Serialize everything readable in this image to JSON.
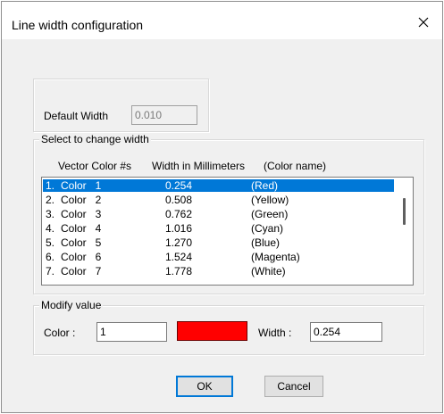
{
  "window": {
    "title": "Line width configuration",
    "close_glyph": "✕"
  },
  "default_width": {
    "label": "Default Width",
    "value": "0.010"
  },
  "select_group": {
    "legend": "Select to change width",
    "headers": {
      "color_col": "Vector Color #s",
      "width_col": "Width in Millimeters",
      "name_col": "(Color name)"
    },
    "rows": [
      {
        "num": "1.",
        "color": "Color   1",
        "width": "0.254",
        "name": "(Red)",
        "selected": true
      },
      {
        "num": "2.",
        "color": "Color   2",
        "width": "0.508",
        "name": "(Yellow)",
        "selected": false
      },
      {
        "num": "3.",
        "color": "Color   3",
        "width": "0.762",
        "name": "(Green)",
        "selected": false
      },
      {
        "num": "4.",
        "color": "Color   4",
        "width": "1.016",
        "name": "(Cyan)",
        "selected": false
      },
      {
        "num": "5.",
        "color": "Color   5",
        "width": "1.270",
        "name": "(Blue)",
        "selected": false
      },
      {
        "num": "6.",
        "color": "Color   6",
        "width": "1.524",
        "name": "(Magenta)",
        "selected": false
      },
      {
        "num": "7.",
        "color": "Color   7",
        "width": "1.778",
        "name": "(White)",
        "selected": false
      }
    ]
  },
  "modify_group": {
    "legend": "Modify value",
    "color_label": "Color :",
    "color_value": "1",
    "swatch_color": "#ff0000",
    "width_label": "Width :",
    "width_value": "0.254"
  },
  "buttons": {
    "ok": "OK",
    "cancel": "Cancel"
  },
  "colors": {
    "selection": "#0078d7",
    "dialog_bg": "#f0f0f0"
  }
}
